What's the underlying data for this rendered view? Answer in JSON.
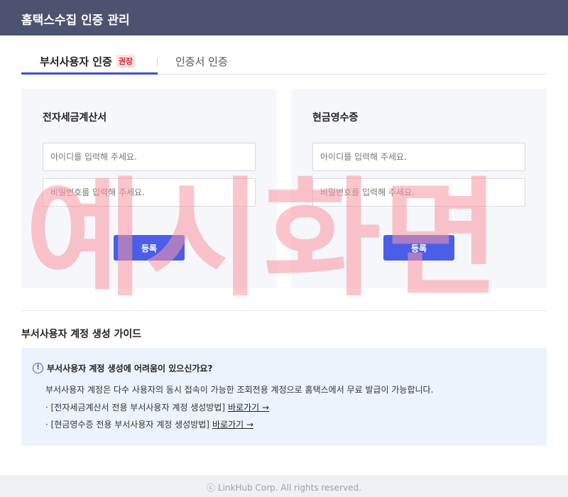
{
  "header": {
    "title": "홈택스수집 인증 관리"
  },
  "tabs": [
    {
      "label": "부서사용자 인증",
      "badge": "권장",
      "active": true
    },
    {
      "label": "인증서 인증",
      "active": false
    }
  ],
  "cards": [
    {
      "title": "전자세금계산서",
      "id_placeholder": "아이디를 입력해 주세요.",
      "pw_placeholder": "비밀번호를 입력해 주세요.",
      "submit_label": "등록"
    },
    {
      "title": "현금영수증",
      "id_placeholder": "아이디를 입력해 주세요.",
      "pw_placeholder": "비밀번호를 입력해 주세요.",
      "submit_label": "등록"
    }
  ],
  "watermark": "예시화면",
  "guide": {
    "heading": "부서사용자 계정 생성 가이드",
    "question": "부서사용자 계정 생성에 어려움이 있으신가요?",
    "description": "부서사용자 계정은 다수 사용자의 동시 접속이 가능한 조회전용 계정으로 홈택스에서 무료 발급이 가능합니다.",
    "lines": [
      {
        "text": "· [전자세금계산서 전용 부서사용자 계정 생성방법]",
        "link": "바로가기 →"
      },
      {
        "text": "· [현금영수증 전용 부서사용자 계정 생성방법]",
        "link": "바로가기 →"
      }
    ]
  },
  "footer": {
    "copyright": "ⓒ LinkHub Corp. All rights reserved."
  },
  "colors": {
    "header_bg": "#4b5370",
    "accent": "#4a5ee8",
    "badge_bg": "#fde2e2",
    "badge_text": "#e02020",
    "guide_bg": "#edf3fc"
  }
}
